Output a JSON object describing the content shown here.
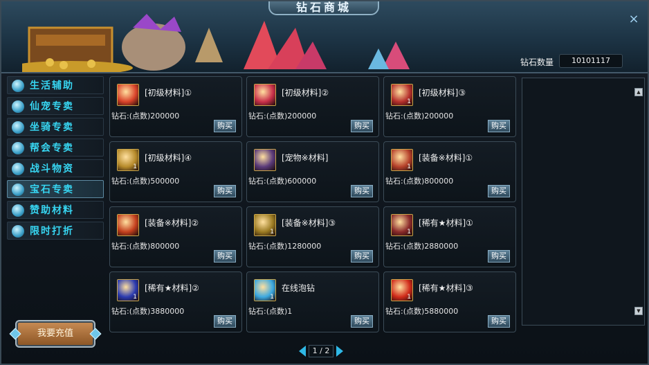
{
  "header": {
    "title": "钻石商城",
    "diamond_label": "钻石数量",
    "diamond_value": "10101117"
  },
  "sidebar": {
    "items": [
      {
        "label": "生活辅助",
        "icon": "potion-icon",
        "active": false
      },
      {
        "label": "仙宠专卖",
        "icon": "paw-icon",
        "active": false
      },
      {
        "label": "坐骑专卖",
        "icon": "horse-icon",
        "active": false
      },
      {
        "label": "帮会专卖",
        "icon": "guild-icon",
        "active": false
      },
      {
        "label": "战斗物资",
        "icon": "box-icon",
        "active": false
      },
      {
        "label": "宝石专卖",
        "icon": "gem-icon",
        "active": true
      },
      {
        "label": "赞助材料",
        "icon": "sponsor-icon",
        "active": false
      },
      {
        "label": "限时打折",
        "icon": "megaphone-icon",
        "active": false
      }
    ],
    "recharge_label": "我要充值"
  },
  "items": [
    {
      "name": "[初级材料]①",
      "price": "钻石:(点数)200000",
      "buy": "购买",
      "qty": "",
      "color": "#d9432a"
    },
    {
      "name": "[初级材料]②",
      "price": "钻石:(点数)200000",
      "buy": "购买",
      "qty": "",
      "color": "#c9304a"
    },
    {
      "name": "[初级材料]③",
      "price": "钻石:(点数)200000",
      "buy": "购买",
      "qty": "1",
      "color": "#b5302c"
    },
    {
      "name": "[初级材料]④",
      "price": "钻石:(点数)500000",
      "buy": "购买",
      "qty": "1",
      "color": "#b68a2a"
    },
    {
      "name": "[宠物※材料]",
      "price": "钻石:(点数)600000",
      "buy": "购买",
      "qty": "",
      "color": "#5a3a7a"
    },
    {
      "name": "[装备※材料]①",
      "price": "钻石:(点数)800000",
      "buy": "购买",
      "qty": "1",
      "color": "#b5402a"
    },
    {
      "name": "[装备※材料]②",
      "price": "钻石:(点数)800000",
      "buy": "购买",
      "qty": "",
      "color": "#c4401e"
    },
    {
      "name": "[装备※材料]③",
      "price": "钻石:(点数)1280000",
      "buy": "购买",
      "qty": "1",
      "color": "#9a7a22"
    },
    {
      "name": "[稀有★材料]①",
      "price": "钻石:(点数)2880000",
      "buy": "购买",
      "qty": "1",
      "color": "#8a2a2a"
    },
    {
      "name": "[稀有★材料]②",
      "price": "钻石:(点数)3880000",
      "buy": "购买",
      "qty": "1",
      "color": "#2a3ab0"
    },
    {
      "name": "在线泡钻",
      "price": "钻石:(点数)1",
      "buy": "购买",
      "qty": "1",
      "color": "#3aa8e0"
    },
    {
      "name": "[稀有★材料]③",
      "price": "钻石:(点数)5880000",
      "buy": "购买",
      "qty": "1",
      "color": "#d02a1a"
    }
  ],
  "pager": {
    "text": "1 / 2"
  },
  "scroll": {
    "up": "▲",
    "down": "▼"
  },
  "close": "×"
}
